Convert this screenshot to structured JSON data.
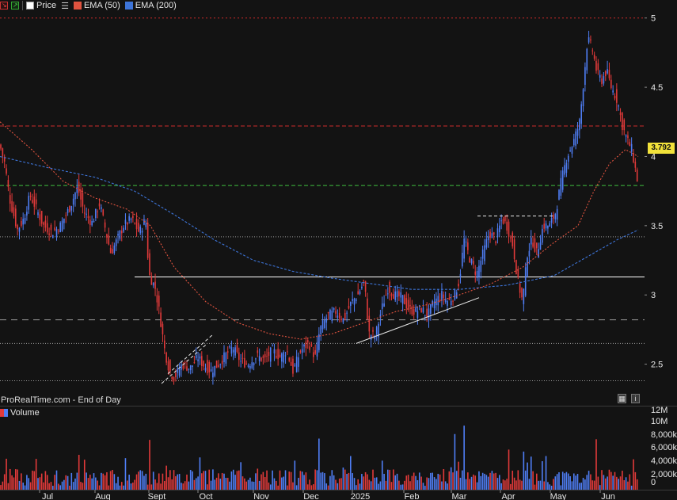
{
  "legend": {
    "price_label": "Price",
    "ema50_label": "EMA (50)",
    "ema200_label": "EMA (200)"
  },
  "watermark": "ProRealTime.com - End of Day",
  "volume_label": "Volume",
  "last_price": "3.792",
  "colors": {
    "background": "#131313",
    "up": "#4f7ef5",
    "down": "#e23a3a",
    "ema50": "#e0533f",
    "ema200": "#3d74d8",
    "resistance": "#cc2b2b",
    "support_green": "#3fbf3f",
    "price_tag": "#f2e23a"
  },
  "chart_data": {
    "type": "candlestick",
    "x_labels": [
      "Jul",
      "Aug",
      "Sept",
      "Oct",
      "Nov",
      "Dec",
      "2025",
      "Feb",
      "Mar",
      "Apr",
      "May",
      "Jun"
    ],
    "price_axis": {
      "ticks": [
        "5",
        "4.5",
        "4",
        "3.5",
        "3",
        "2.5"
      ],
      "ylim": [
        2.2,
        5.05
      ]
    },
    "volume_axis": {
      "ticks": [
        "12M",
        "10M",
        "8,000k",
        "6,000k",
        "4,000k",
        "2,000k",
        "0"
      ],
      "ylim": [
        0,
        12000
      ]
    },
    "levels": [
      {
        "value": 5.0,
        "style": "red-dotted"
      },
      {
        "value": 4.22,
        "style": "red-dashed"
      },
      {
        "value": 3.79,
        "style": "green-dashed"
      },
      {
        "value": 3.42,
        "style": "gray-dotted"
      },
      {
        "value": 3.13,
        "style": "white-solid"
      },
      {
        "value": 2.82,
        "style": "gray-dashed"
      },
      {
        "value": 2.65,
        "style": "gray-dotted"
      },
      {
        "value": 2.38,
        "style": "gray-dotted"
      }
    ],
    "price_path": [
      [
        0,
        4.08
      ],
      [
        6,
        3.95
      ],
      [
        12,
        3.7
      ],
      [
        22,
        3.47
      ],
      [
        30,
        3.55
      ],
      [
        38,
        3.72
      ],
      [
        46,
        3.62
      ],
      [
        55,
        3.5
      ],
      [
        66,
        3.45
      ],
      [
        76,
        3.5
      ],
      [
        88,
        3.63
      ],
      [
        98,
        3.78
      ],
      [
        106,
        3.6
      ],
      [
        116,
        3.52
      ],
      [
        126,
        3.66
      ],
      [
        134,
        3.45
      ],
      [
        140,
        3.3
      ],
      [
        148,
        3.4
      ],
      [
        156,
        3.5
      ],
      [
        166,
        3.55
      ],
      [
        176,
        3.45
      ],
      [
        184,
        3.55
      ],
      [
        188,
        3.15
      ],
      [
        196,
        3.05
      ],
      [
        202,
        2.85
      ],
      [
        208,
        2.6
      ],
      [
        214,
        2.45
      ],
      [
        220,
        2.4
      ],
      [
        230,
        2.5
      ],
      [
        240,
        2.47
      ],
      [
        250,
        2.55
      ],
      [
        256,
        2.5
      ],
      [
        266,
        2.45
      ],
      [
        276,
        2.5
      ],
      [
        284,
        2.56
      ],
      [
        294,
        2.62
      ],
      [
        304,
        2.52
      ],
      [
        314,
        2.5
      ],
      [
        324,
        2.56
      ],
      [
        334,
        2.53
      ],
      [
        344,
        2.6
      ],
      [
        354,
        2.55
      ],
      [
        362,
        2.6
      ],
      [
        370,
        2.45
      ],
      [
        380,
        2.6
      ],
      [
        390,
        2.65
      ],
      [
        398,
        2.55
      ],
      [
        404,
        2.75
      ],
      [
        414,
        2.85
      ],
      [
        424,
        2.88
      ],
      [
        434,
        2.82
      ],
      [
        444,
        2.95
      ],
      [
        452,
        3.0
      ],
      [
        460,
        3.1
      ],
      [
        466,
        2.72
      ],
      [
        474,
        2.7
      ],
      [
        482,
        2.9
      ],
      [
        490,
        3.05
      ],
      [
        498,
        3.0
      ],
      [
        508,
        2.98
      ],
      [
        516,
        2.9
      ],
      [
        524,
        2.88
      ],
      [
        532,
        2.9
      ],
      [
        540,
        2.85
      ],
      [
        548,
        2.95
      ],
      [
        558,
        3.0
      ],
      [
        566,
        2.95
      ],
      [
        574,
        3.0
      ],
      [
        580,
        3.1
      ],
      [
        586,
        3.4
      ],
      [
        594,
        3.25
      ],
      [
        602,
        3.15
      ],
      [
        610,
        3.3
      ],
      [
        618,
        3.45
      ],
      [
        626,
        3.4
      ],
      [
        634,
        3.55
      ],
      [
        640,
        3.5
      ],
      [
        648,
        3.35
      ],
      [
        654,
        3.1
      ],
      [
        660,
        2.95
      ],
      [
        666,
        3.3
      ],
      [
        672,
        3.4
      ],
      [
        678,
        3.3
      ],
      [
        686,
        3.5
      ],
      [
        694,
        3.5
      ],
      [
        702,
        3.6
      ],
      [
        708,
        3.8
      ],
      [
        716,
        4.0
      ],
      [
        724,
        4.1
      ],
      [
        732,
        4.25
      ],
      [
        738,
        4.6
      ],
      [
        742,
        4.85
      ],
      [
        748,
        4.78
      ],
      [
        754,
        4.6
      ],
      [
        760,
        4.55
      ],
      [
        766,
        4.62
      ],
      [
        772,
        4.5
      ],
      [
        780,
        4.4
      ],
      [
        786,
        4.22
      ],
      [
        792,
        4.12
      ],
      [
        798,
        4.05
      ],
      [
        806,
        3.79
      ]
    ],
    "ema50": [
      [
        0,
        4.25
      ],
      [
        40,
        4.05
      ],
      [
        80,
        3.82
      ],
      [
        120,
        3.7
      ],
      [
        160,
        3.62
      ],
      [
        190,
        3.5
      ],
      [
        220,
        3.2
      ],
      [
        260,
        2.95
      ],
      [
        300,
        2.8
      ],
      [
        340,
        2.72
      ],
      [
        380,
        2.68
      ],
      [
        420,
        2.72
      ],
      [
        460,
        2.8
      ],
      [
        500,
        2.88
      ],
      [
        540,
        2.93
      ],
      [
        580,
        3.0
      ],
      [
        620,
        3.08
      ],
      [
        660,
        3.2
      ],
      [
        700,
        3.38
      ],
      [
        730,
        3.5
      ],
      [
        750,
        3.75
      ],
      [
        770,
        3.95
      ],
      [
        790,
        4.05
      ],
      [
        806,
        4.0
      ]
    ],
    "ema200": [
      [
        0,
        4.0
      ],
      [
        60,
        3.92
      ],
      [
        120,
        3.85
      ],
      [
        170,
        3.75
      ],
      [
        220,
        3.58
      ],
      [
        270,
        3.4
      ],
      [
        320,
        3.25
      ],
      [
        370,
        3.17
      ],
      [
        420,
        3.12
      ],
      [
        470,
        3.08
      ],
      [
        520,
        3.04
      ],
      [
        580,
        3.04
      ],
      [
        640,
        3.07
      ],
      [
        700,
        3.14
      ],
      [
        740,
        3.27
      ],
      [
        780,
        3.4
      ],
      [
        806,
        3.47
      ]
    ],
    "trendlines": [
      {
        "from": [
          204,
          2.36
        ],
        "to": [
          262,
          2.65
        ],
        "style": "white-dashed"
      },
      {
        "from": [
          212,
          2.43
        ],
        "to": [
          270,
          2.72
        ],
        "style": "white-dashed"
      },
      {
        "from": [
          450,
          2.65
        ],
        "to": [
          605,
          2.98
        ],
        "style": "white-solid"
      },
      {
        "from": [
          603,
          3.57
        ],
        "to": [
          700,
          3.57
        ],
        "style": "white-dashed"
      }
    ],
    "volume_hint": "bars sized per day; spikes near Sept, Dec, Mar, Apr, May"
  }
}
